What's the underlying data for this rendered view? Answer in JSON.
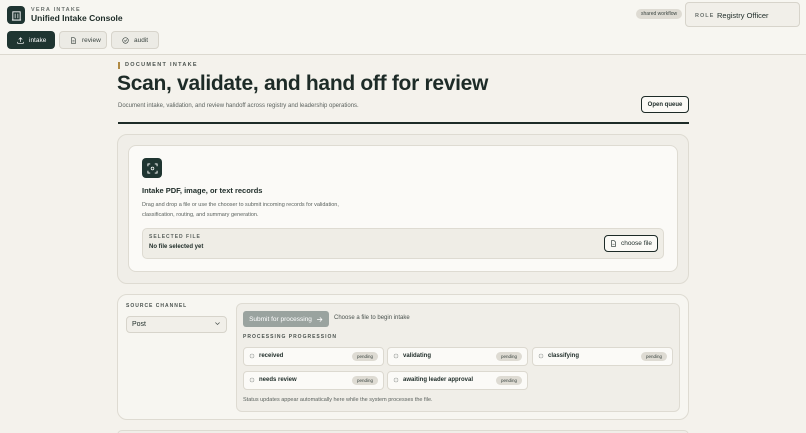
{
  "header": {
    "brand_small": "VERA INTAKE",
    "brand_title": "Unified Intake Console",
    "workflow_badge": "shared workflow",
    "role_label": "ROLE",
    "role_value": "Registry Officer"
  },
  "tabs": [
    {
      "label": "intake",
      "icon": "upload-icon",
      "active": true
    },
    {
      "label": "review",
      "icon": "document-icon",
      "active": false
    },
    {
      "label": "audit",
      "icon": "shield-check-icon",
      "active": false
    }
  ],
  "hero": {
    "eyebrow": "DOCUMENT INTAKE",
    "title": "Scan, validate, and hand off for review",
    "subtitle": "Document intake, validation, and review handoff across registry and leadership operations.",
    "open_queue": "Open queue"
  },
  "intake": {
    "icon": "scan-icon",
    "title": "Intake PDF, image, or text records",
    "description": "Drag and drop a file or use the chooser to submit incoming records for validation, classification, routing, and summary generation.",
    "selected_label": "SELECTED FILE",
    "selected_value": "No file selected yet",
    "choose_file": "choose file"
  },
  "processing": {
    "source_label": "SOURCE CHANNEL",
    "source_value": "Post",
    "submit_label": "Submit for processing",
    "submit_hint": "Choose a file to begin intake",
    "progress_label": "PROCESSING PROGRESSION",
    "stages": [
      {
        "name": "received",
        "status": "pending"
      },
      {
        "name": "validating",
        "status": "pending"
      },
      {
        "name": "classifying",
        "status": "pending"
      },
      {
        "name": "needs review",
        "status": "pending"
      },
      {
        "name": "awaiting leader approval",
        "status": "pending"
      }
    ],
    "status_note": "Status updates appear automatically here while the system processes the file."
  },
  "colors": {
    "accent": "#1f3531",
    "background": "#f4f2ec",
    "eyebrow_bar": "#b08a44",
    "disabled_button": "#9aa39f"
  }
}
